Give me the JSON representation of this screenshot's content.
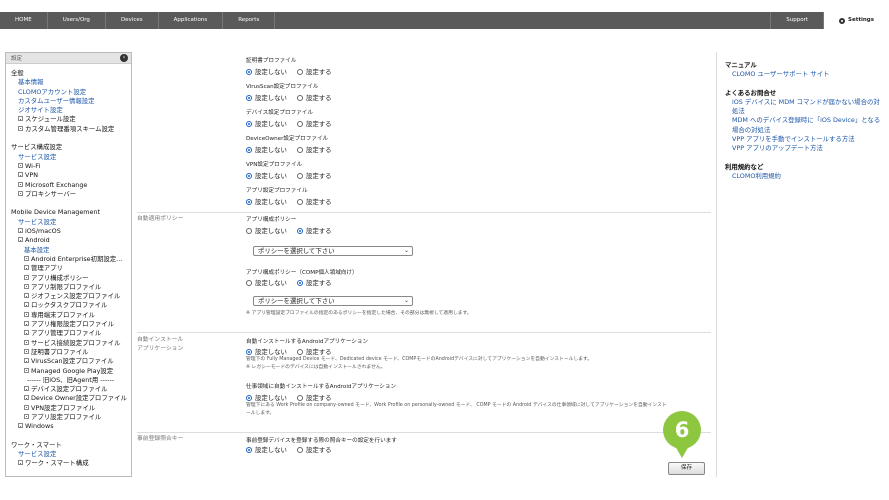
{
  "topnav": {
    "tabs": [
      "HOME",
      "Users/Org",
      "Devices",
      "Applications",
      "Reports"
    ],
    "support": "Support",
    "settings": "Settings"
  },
  "sidebar": {
    "header": "設定",
    "general": {
      "title": "全般",
      "links": [
        "基本情報",
        "CLOMOアカウント設定",
        "カスタムユーザー情報設定",
        "ジオサイト設定"
      ],
      "items": [
        "スケジュール設定",
        "カスタム管理番項スキーム設定"
      ]
    },
    "service": {
      "title": "サービス構成設定",
      "link": "サービス設定",
      "items": [
        "Wi-Fi",
        "VPN",
        "Microsoft Exchange",
        "プロキシサーバー"
      ]
    },
    "mdm": {
      "title": "Mobile Device Management",
      "link": "サービス設定",
      "items_top": [
        "iOS/macOS",
        "Android"
      ],
      "android_link": "基本設定",
      "android_items": [
        "Android Enterprise初期設定...",
        "管理アプリ",
        "アプリ構成ポリシー",
        "アプリ制限プロファイル",
        "ジオフェンス設定プロファイル",
        "ロックタスクプロファイル",
        "専用端末プロファイル",
        "アプリ権限設定プロファイル",
        "アプリ管理プロファイル",
        "サービス接続設定プロファイル",
        "証明書プロファイル",
        "VirusScan設定プロファイル",
        "Managed Google Play設定"
      ],
      "separator": "------ 旧iOS、旧Agent用 ------",
      "legacy_items": [
        "デバイス設定プロファイル",
        "Device Owner設定プロファイル",
        "VPN設定プロファイル",
        "アプリ設定プロファイル"
      ],
      "windows": "Windows"
    },
    "workstyle": {
      "title": "ワーク・スマート",
      "link": "サービス設定",
      "items": [
        "ワーク・スマート構成"
      ]
    }
  },
  "main": {
    "profiles": [
      {
        "label": "証明書プロファイル",
        "opt_off": "設定しない",
        "opt_on": "設定する"
      },
      {
        "label": "VirusScan設定プロファイル",
        "opt_off": "設定しない",
        "opt_on": "設定する"
      },
      {
        "label": "デバイス設定プロファイル",
        "opt_off": "設定しない",
        "opt_on": "設定する"
      },
      {
        "label": "DeviceOwner設定プロファイル",
        "opt_off": "設定しない",
        "opt_on": "設定する"
      },
      {
        "label": "VPN設定プロファイル",
        "opt_off": "設定しない",
        "opt_on": "設定する"
      },
      {
        "label": "アプリ設定プロファイル",
        "opt_off": "設定しない",
        "opt_on": "設定する"
      }
    ],
    "auto_policy": {
      "section": "自動適用ポリシー",
      "f1_label": "アプリ構成ポリシー",
      "f1_off": "設定しない",
      "f1_on": "設定する",
      "f1_select": "ポリシーを選択して下さい",
      "f2_label": "アプリ構成ポリシー（COMP個人領域向け）",
      "f2_off": "設定しない",
      "f2_on": "設定する",
      "f2_select": "ポリシーを選択して下さい",
      "note": "※ アプリ管理設定プロファイルの指定のあるポリシーを指定した場合、その部分は無視して適用します。"
    },
    "auto_install": {
      "section_l1": "自動インストール",
      "section_l2": "アプリケーション",
      "f1_label": "自動インストールするAndroidアプリケーション",
      "f1_off": "設定しない",
      "f1_on": "設定する",
      "f1_note1": "管理下の Fully Managed Device モード、Dedicated device モード、COMPモードのAndroidデバイスに対してアプリケーションを自動インストールします。",
      "f1_note2": "※ レガシーモードのデバイスには自動インストールされません。",
      "f2_label": "仕事領域に自動インストールするAndroidアプリケーション",
      "f2_off": "設定しない",
      "f2_on": "設定する",
      "f2_note1": "管理下にある Work Profile on company-owned モード、Work Profile on personally-owned モード、 COMP モードの Android デバイスの仕事領域に対してアプリケーションを自動インスト",
      "f2_note2": "ールします。"
    },
    "preregistration": {
      "section": "事前登録照合キー",
      "label": "事前登録デバイスを登録する際の照合キーの設定を行います",
      "opt_off": "設定しない",
      "opt_on": "設定する"
    },
    "save_label": "保存",
    "marker_label": "6"
  },
  "rightpanel": {
    "manual_title": "マニュアル",
    "manual_link": "CLOMO ユーザーサポート サイト",
    "faq_title": "よくあるお問合せ",
    "faq_links": [
      "iOS デバイスに MDM コマンドが届かない場合の対処法",
      "MDM へのデバイス登録時に「iOS Device」となる場合の対処法",
      "VPP アプリを手動でインストールする方法",
      "VPP アプリのアップデート方法"
    ],
    "terms_title": "利用規約など",
    "terms_link": "CLOMO利用規約"
  }
}
